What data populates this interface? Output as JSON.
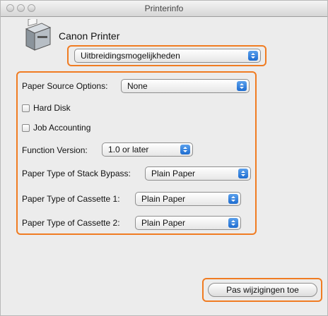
{
  "window": {
    "title": "Printerinfo"
  },
  "header": {
    "printer_name": "Canon Printer"
  },
  "panel_selector": {
    "selected": "Uitbreidingsmogelijkheden"
  },
  "options": {
    "paper_source": {
      "label": "Paper Source Options:",
      "value": "None"
    },
    "hard_disk": {
      "label": "Hard Disk",
      "checked": false
    },
    "job_accounting": {
      "label": "Job Accounting",
      "checked": false
    },
    "function_version": {
      "label": "Function Version:",
      "value": "1.0 or later"
    },
    "stack_bypass": {
      "label": "Paper Type of Stack Bypass:",
      "value": "Plain Paper"
    },
    "cassette1": {
      "label": "Paper Type of Cassette 1:",
      "value": "Plain Paper"
    },
    "cassette2": {
      "label": "Paper Type of Cassette 2:",
      "value": "Plain Paper"
    }
  },
  "footer": {
    "apply_label": "Pas wijzigingen toe"
  },
  "colors": {
    "highlight": "#f07c22",
    "popup_arrow": "#2b78d8"
  },
  "icons": [
    "printer-icon",
    "popup-arrows-icon",
    "checkbox"
  ]
}
